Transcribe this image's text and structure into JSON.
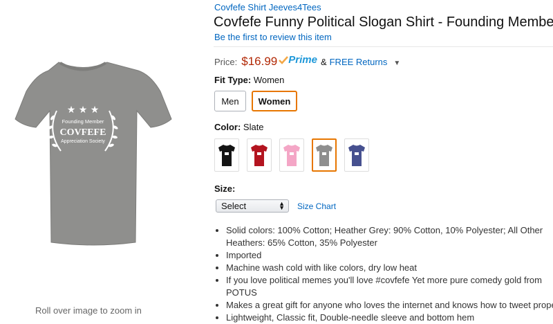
{
  "product": {
    "brand": "Covfefe Shirt Jeeves4Tees",
    "title": "Covfefe Funny Political Slogan Shirt - Founding Member",
    "review_link": "Be the first to review this item"
  },
  "image": {
    "zoom_hint": "Roll over image to zoom in",
    "print_line1": "Founding Member",
    "print_line2": "COVFEFE",
    "print_line3": "Appreciation Society",
    "shirt_color": "#8f8f8d"
  },
  "price": {
    "label": "Price:",
    "value": "$16.99",
    "prime": "Prime",
    "amp": "&",
    "free_returns": "FREE Returns"
  },
  "fit": {
    "label": "Fit Type:",
    "selected": "Women",
    "options": [
      "Men",
      "Women"
    ]
  },
  "color": {
    "label": "Color:",
    "selected": "Slate",
    "swatches": [
      {
        "name": "Black",
        "hex": "#141414"
      },
      {
        "name": "Red",
        "hex": "#b3141f"
      },
      {
        "name": "Pink",
        "hex": "#f4a6c6"
      },
      {
        "name": "Slate",
        "hex": "#8e8e8e"
      },
      {
        "name": "Royal",
        "hex": "#46508f"
      }
    ]
  },
  "size": {
    "label": "Size:",
    "select_value": "Select",
    "chart_link": "Size Chart"
  },
  "features": [
    "Solid colors: 100% Cotton; Heather Grey: 90% Cotton, 10% Polyester; All Other Heathers: 65% Cotton, 35% Polyester",
    "Imported",
    "Machine wash cold with like colors, dry low heat",
    "If you love political memes you'll love #covfefe Yet more pure comedy gold from POTUS",
    "Makes a great gift for anyone who loves the internet and knows how to tweet properly",
    "Lightweight, Classic fit, Double-needle sleeve and bottom hem"
  ]
}
